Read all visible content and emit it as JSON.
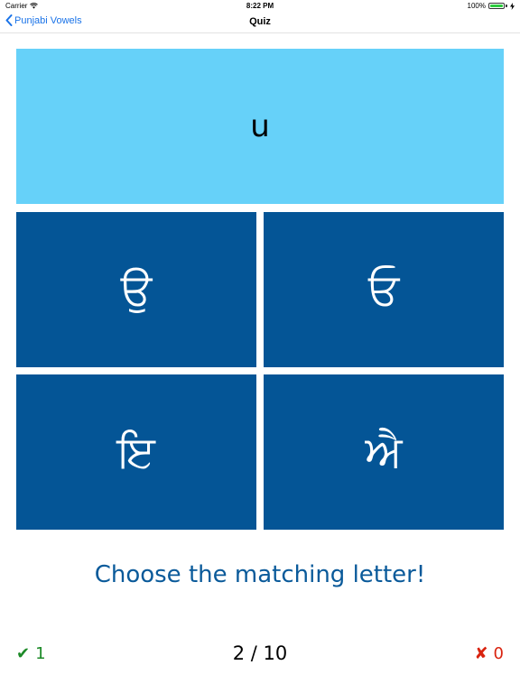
{
  "status_bar": {
    "carrier": "Carrier",
    "time": "8:22 PM",
    "battery": "100%",
    "battery_level": 1.0
  },
  "nav": {
    "back_label": "Punjabi Vowels",
    "title": "Quiz"
  },
  "prompt": {
    "letter": "u"
  },
  "options": [
    "ਉ",
    "ਓ",
    "ਇ",
    "ਐ"
  ],
  "instruction": "Choose the matching letter!",
  "footer": {
    "correct_icon": "✔",
    "correct_count": "1",
    "progress": "2 / 10",
    "wrong_icon": "✘",
    "wrong_count": "0"
  },
  "colors": {
    "prompt_bg": "#66d1f9",
    "option_bg": "#045596",
    "instruction": "#0a5a9a",
    "correct": "#1d8a28",
    "wrong": "#d9230f",
    "link": "#1a73e8"
  }
}
